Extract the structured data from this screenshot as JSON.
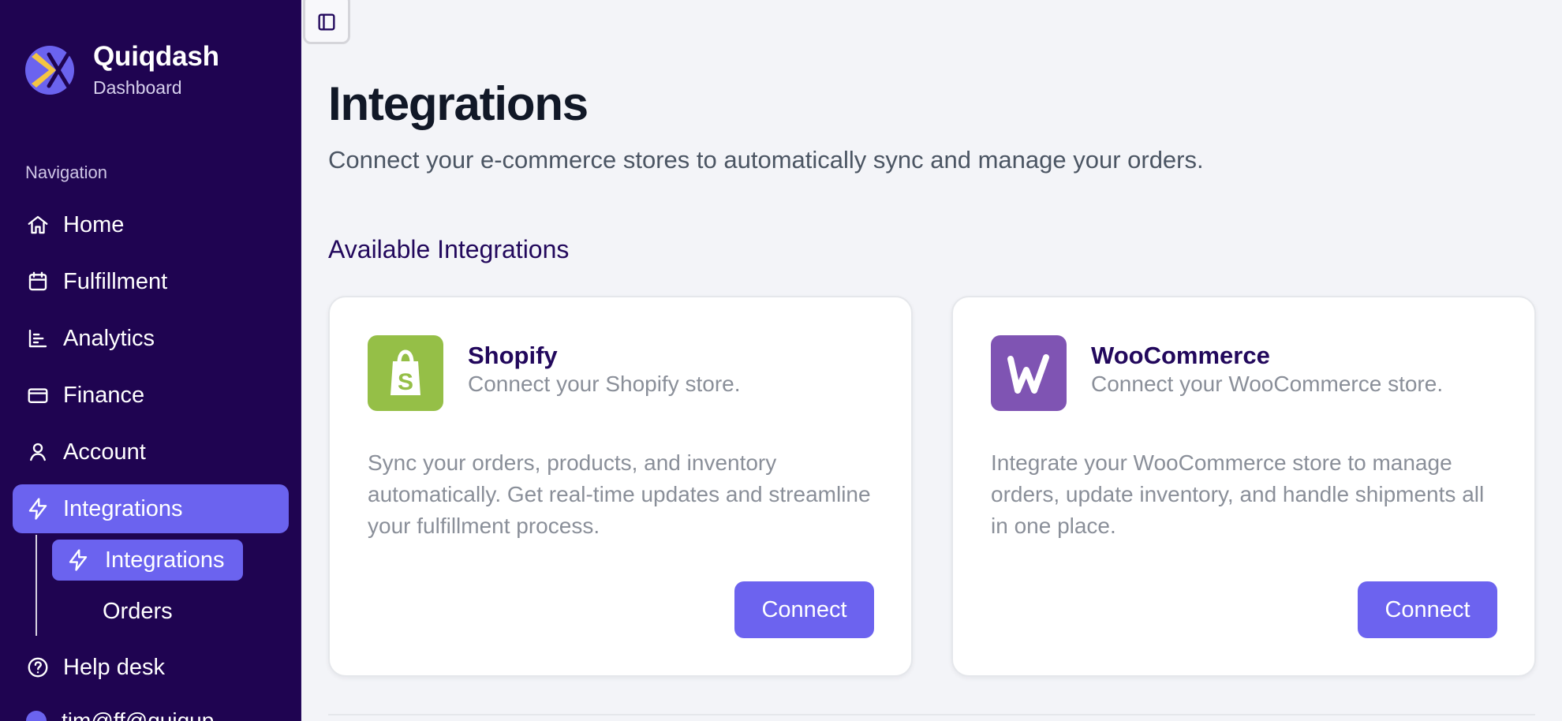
{
  "brand": {
    "name": "Quiqdash",
    "subtitle": "Dashboard",
    "logo_icon": "quiqdash-logo",
    "accent_color": "#6b63ef",
    "sidebar_color": "#1f0451"
  },
  "sidebar": {
    "nav_title": "Navigation",
    "items": [
      {
        "label": "Home",
        "icon": "home-icon",
        "active": false
      },
      {
        "label": "Fulfillment",
        "icon": "calendar-icon",
        "active": false
      },
      {
        "label": "Analytics",
        "icon": "chart-icon",
        "active": false
      },
      {
        "label": "Finance",
        "icon": "credit-card-icon",
        "active": false
      },
      {
        "label": "Account",
        "icon": "user-icon",
        "active": false
      },
      {
        "label": "Integrations",
        "icon": "lightning-icon",
        "active": true
      },
      {
        "label": "Help desk",
        "icon": "help-circle-icon",
        "active": false
      }
    ],
    "subitems": [
      {
        "label": "Integrations",
        "icon": "lightning-icon",
        "active": true
      },
      {
        "label": "Orders",
        "icon": "",
        "active": false
      }
    ],
    "user_label": "tim@ff@quiqup"
  },
  "header": {
    "toggle_icon": "sidebar-toggle-icon"
  },
  "page": {
    "title": "Integrations",
    "description": "Connect your e-commerce stores to automatically sync and manage your orders.",
    "section_title": "Available Integrations"
  },
  "cards": [
    {
      "name": "Shopify",
      "subtitle": "Connect your Shopify store.",
      "body": "Sync your orders, products, and inventory automatically. Get real-time updates and streamline your fulfillment process.",
      "button_label": "Connect",
      "logo_icon": "shopify-logo-icon",
      "logo_color": "#95bf47"
    },
    {
      "name": "WooCommerce",
      "subtitle": "Connect your WooCommerce store.",
      "body": "Integrate your WooCommerce store to manage orders, update inventory, and handle shipments all in one place.",
      "button_label": "Connect",
      "logo_icon": "woocommerce-logo-icon",
      "logo_color": "#7f54b3"
    }
  ]
}
